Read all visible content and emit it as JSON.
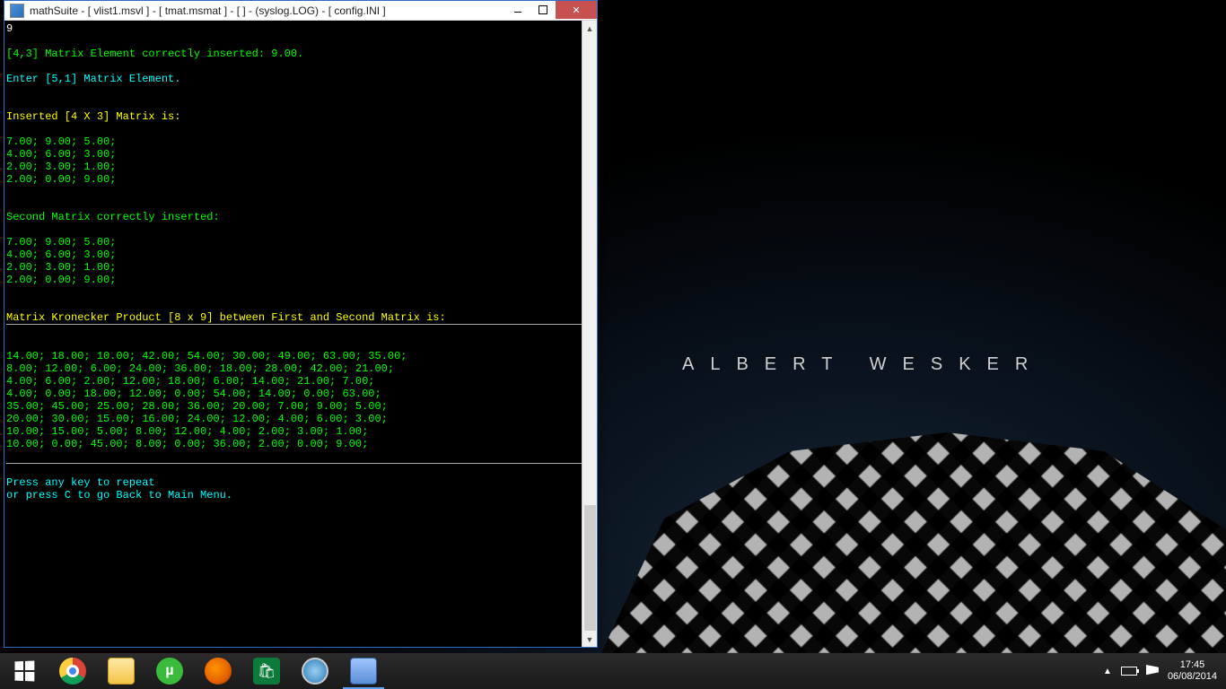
{
  "window": {
    "title": "mathSuite - [ vlist1.msvl ] - [ tmat.msmat ] - [  ] - (syslog.LOG) - [ config.INI ]"
  },
  "console": {
    "input_value": "9",
    "msg_inserted": "[4,3] Matrix Element correctly inserted: 9.00.",
    "prompt_enter": "Enter [5,1] Matrix Element.",
    "heading_inserted_matrix": "Inserted [4 X 3] Matrix is:",
    "matrix_a": {
      "rows": 4,
      "cols": 3,
      "data": [
        [
          7.0,
          9.0,
          5.0
        ],
        [
          4.0,
          6.0,
          3.0
        ],
        [
          2.0,
          3.0,
          1.0
        ],
        [
          2.0,
          0.0,
          9.0
        ]
      ],
      "lines": [
        "7.00; 9.00; 5.00;",
        "4.00; 6.00; 3.00;",
        "2.00; 3.00; 1.00;",
        "2.00; 0.00; 9.00;"
      ]
    },
    "heading_second": "Second Matrix correctly inserted:",
    "matrix_b": {
      "rows": 4,
      "cols": 3,
      "data": [
        [
          7.0,
          9.0,
          5.0
        ],
        [
          4.0,
          6.0,
          3.0
        ],
        [
          2.0,
          3.0,
          1.0
        ],
        [
          2.0,
          0.0,
          9.0
        ]
      ],
      "lines": [
        "7.00; 9.00; 5.00;",
        "4.00; 6.00; 3.00;",
        "2.00; 3.00; 1.00;",
        "2.00; 0.00; 9.00;"
      ]
    },
    "heading_kron": "Matrix Kronecker Product [8 x 9] between First and Second Matrix is:",
    "kron": {
      "rows": 8,
      "cols": 9,
      "lines": [
        "14.00; 18.00; 10.00; 42.00; 54.00; 30.00; 49.00; 63.00; 35.00;",
        "8.00; 12.00; 6.00; 24.00; 36.00; 18.00; 28.00; 42.00; 21.00;",
        "4.00; 6.00; 2.00; 12.00; 18.00; 6.00; 14.00; 21.00; 7.00;",
        "4.00; 0.00; 18.00; 12.00; 0.00; 54.00; 14.00; 0.00; 63.00;",
        "35.00; 45.00; 25.00; 28.00; 36.00; 20.00; 7.00; 9.00; 5.00;",
        "20.00; 30.00; 15.00; 16.00; 24.00; 12.00; 4.00; 6.00; 3.00;",
        "10.00; 15.00; 5.00; 8.00; 12.00; 4.00; 2.00; 3.00; 1.00;",
        "10.00; 0.00; 45.00; 8.00; 0.00; 36.00; 2.00; 0.00; 9.00;"
      ]
    },
    "footer_line1": "Press any key to repeat",
    "footer_line2": "or press C to go Back to Main Menu."
  },
  "wallpaper": {
    "caption": "ALBERT WESKER"
  },
  "taskbar": {
    "items": [
      {
        "name": "chrome",
        "label": "Google Chrome"
      },
      {
        "name": "explorer",
        "label": "File Explorer"
      },
      {
        "name": "utorrent",
        "label": "µTorrent",
        "glyph": "µ"
      },
      {
        "name": "firefox",
        "label": "Firefox"
      },
      {
        "name": "store",
        "label": "Store",
        "glyph": "🛍"
      },
      {
        "name": "itunes",
        "label": "iTunes"
      },
      {
        "name": "calc",
        "label": "Calculator"
      }
    ],
    "clock_time": "17:45",
    "clock_date": "06/08/2014"
  }
}
